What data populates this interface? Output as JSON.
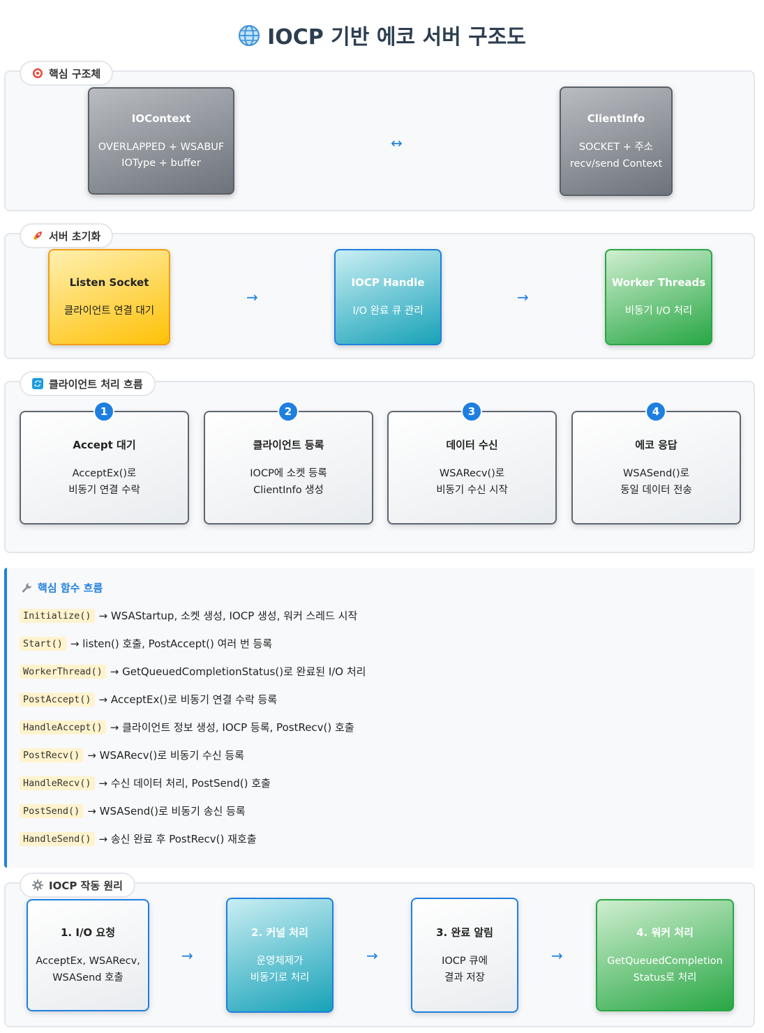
{
  "title": "IOCP 기반 에코 서버 구조도",
  "struct_section": {
    "tag": "핵심 구조체",
    "box1": {
      "title": "IOContext",
      "line1": "OVERLAPPED + WSABUF",
      "line2": "IOType + buffer"
    },
    "arrow": "↔",
    "box2": {
      "title": "ClientInfo",
      "line1": "SOCKET + 주소",
      "line2": "recv/send Context"
    }
  },
  "init_section": {
    "tag": "서버 초기화",
    "box1": {
      "title": "Listen Socket",
      "desc": "클라이언트 연결 대기"
    },
    "box2": {
      "title": "IOCP Handle",
      "desc": "I/O 완료 큐 관리"
    },
    "box3": {
      "title": "Worker Threads",
      "desc": "비동기 I/O 처리"
    },
    "arrow": "→"
  },
  "flow_section": {
    "tag": "클라이언트 처리 흐름",
    "steps": [
      {
        "num": "1",
        "title": "Accept 대기",
        "line1": "AcceptEx()로",
        "line2": "비동기 연결 수락"
      },
      {
        "num": "2",
        "title": "클라이언트 등록",
        "line1": "IOCP에 소켓 등록",
        "line2": "ClientInfo 생성"
      },
      {
        "num": "3",
        "title": "데이터 수신",
        "line1": "WSARecv()로",
        "line2": "비동기 수신 시작"
      },
      {
        "num": "4",
        "title": "에코 응답",
        "line1": "WSASend()로",
        "line2": "동일 데이터 전송"
      }
    ]
  },
  "functions": {
    "title": "핵심 함수 흐름",
    "items": [
      {
        "name": "Initialize()",
        "desc": "→ WSAStartup, 소켓 생성, IOCP 생성, 워커 스레드 시작"
      },
      {
        "name": "Start()",
        "desc": "→ listen() 호출, PostAccept() 여러 번 등록"
      },
      {
        "name": "WorkerThread()",
        "desc": "→ GetQueuedCompletionStatus()로 완료된 I/O 처리"
      },
      {
        "name": "PostAccept()",
        "desc": "→ AcceptEx()로 비동기 연결 수락 등록"
      },
      {
        "name": "HandleAccept()",
        "desc": "→ 클라이언트 정보 생성, IOCP 등록, PostRecv() 호출"
      },
      {
        "name": "PostRecv()",
        "desc": "→ WSARecv()로 비동기 수신 등록"
      },
      {
        "name": "HandleRecv()",
        "desc": "→ 수신 데이터 처리, PostSend() 호출"
      },
      {
        "name": "PostSend()",
        "desc": "→ WSASend()로 비동기 송신 등록"
      },
      {
        "name": "HandleSend()",
        "desc": "→ 송신 완료 후 PostRecv() 재호출"
      }
    ]
  },
  "principle_section": {
    "tag": "IOCP 작동 원리",
    "box1": {
      "title": "1. I/O 요청",
      "line1": "AcceptEx, WSARecv,",
      "line2": "WSASend 호출"
    },
    "box2": {
      "title": "2. 커널 처리",
      "line1": "운영체제가",
      "line2": "비동기로 처리"
    },
    "box3": {
      "title": "3. 완료 알림",
      "line1": "IOCP 큐에",
      "line2": "결과 저장"
    },
    "box4": {
      "title": "4. 워커 처리",
      "line1": "GetQueuedCompletion",
      "line2": "Status로 처리"
    },
    "arrow": "→"
  },
  "colors": {
    "accent": "#1e7fe0",
    "code_bg": "#fff3cd"
  }
}
